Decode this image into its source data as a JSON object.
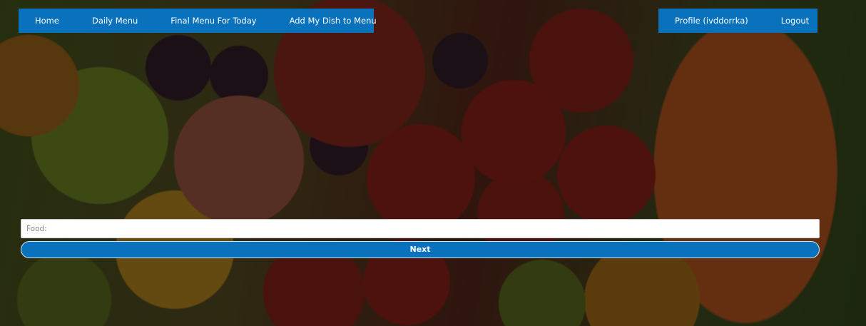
{
  "nav": {
    "left_links": [
      {
        "label": "Home"
      },
      {
        "label": "Daily Menu"
      },
      {
        "label": "Final Menu For Today"
      },
      {
        "label": "Add My Dish to Menu"
      }
    ],
    "right_links": [
      {
        "label": "Profile (ivddorrka)"
      },
      {
        "label": "Logout"
      }
    ],
    "color": "#0a71bd"
  },
  "form": {
    "food_placeholder": "Food:",
    "food_value": "",
    "next_label": "Next"
  }
}
